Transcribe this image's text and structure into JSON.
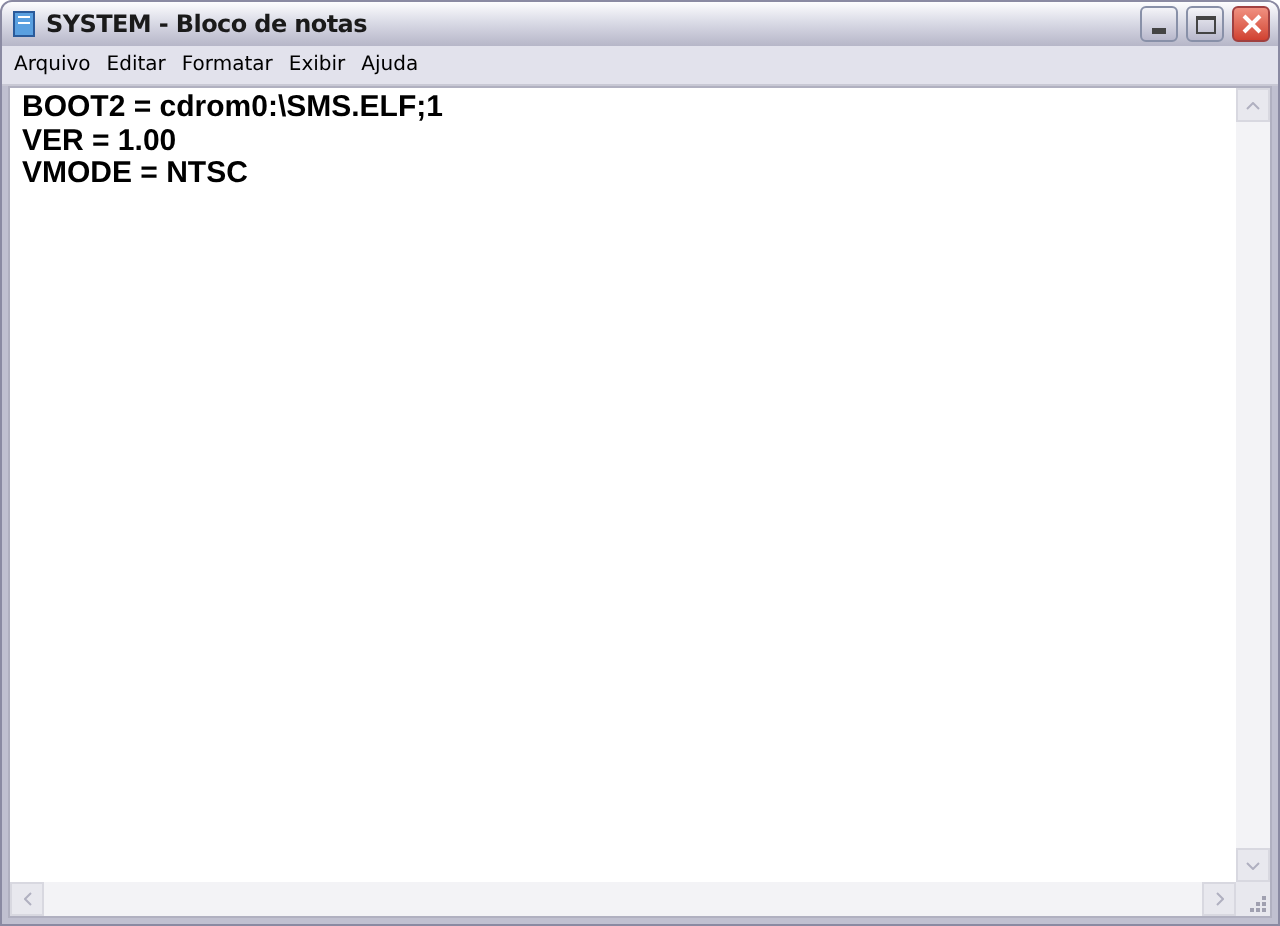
{
  "window": {
    "title": "SYSTEM - Bloco de notas"
  },
  "menu": [
    "Arquivo",
    "Editar",
    "Formatar",
    "Exibir",
    "Ajuda"
  ],
  "document": {
    "lines": [
      "BOOT2 = cdrom0:\\SMS.ELF;1",
      "VER = 1.00",
      "VMODE = NTSC"
    ]
  }
}
